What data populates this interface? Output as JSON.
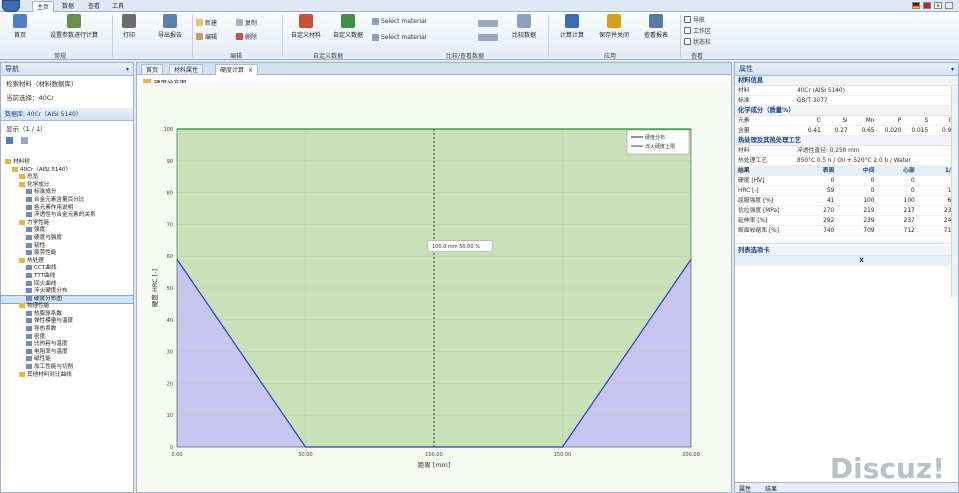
{
  "ribbon_tabs": [
    "主页",
    "数据",
    "查看",
    "工具"
  ],
  "ribbon": {
    "buttons": [
      {
        "name": "home-button",
        "label": "首页",
        "color": "#4f7fc4"
      },
      {
        "name": "params-button",
        "label": "设置参数进行计算",
        "color": "#6b8e4e"
      },
      {
        "name": "print-button",
        "label": "打印",
        "color": "#6c6c6c"
      },
      {
        "name": "export-button",
        "label": "导出报告",
        "color": "#5b7fae"
      },
      {
        "name": "customize-button",
        "label": "自定义材料",
        "color": "#c6503a"
      },
      {
        "name": "library-button",
        "label": "自定义数据",
        "color": "#3f8f49"
      },
      {
        "name": "compare-button",
        "label": "比较数据",
        "color": "#8aa0bd"
      },
      {
        "name": "calc-button",
        "label": "计算计算",
        "color": "#3c6cb0"
      },
      {
        "name": "save-results-button",
        "label": "保存并关闭",
        "color": "#d4a01e"
      },
      {
        "name": "report-button",
        "label": "查看报表",
        "color": "#5a78a2"
      }
    ],
    "small_items": [
      "新建",
      "复制",
      "删除",
      "编辑",
      "Select material",
      "Select material"
    ],
    "groups": [
      "常规",
      "编辑",
      "自定义数据",
      "比较/查看数据",
      "应用",
      "查看"
    ],
    "right_items": [
      "导航",
      "工作区",
      "状态栏"
    ]
  },
  "flags": [
    "#1a1a1a",
    "#c02626",
    "#ffffff"
  ],
  "left_panel": {
    "title": "导航",
    "line1": "检索材料（材料数据库）",
    "line2": "当前选择：40Cr",
    "section": "数据库: 40Cr（AISI 5140）",
    "toolbar": "显示（1 / 1）",
    "tree": [
      {
        "level": 0,
        "label": "材料树"
      },
      {
        "level": 1,
        "label": "40Cr（AISI 5140）"
      },
      {
        "level": 2,
        "label": "总览"
      },
      {
        "level": 2,
        "label": "化学成分"
      },
      {
        "level": 3,
        "label": "标准成分"
      },
      {
        "level": 3,
        "label": "合金元素含量百分比"
      },
      {
        "level": 3,
        "label": "各元素作用说明"
      },
      {
        "level": 3,
        "label": "淬透性与合金元素的关系"
      },
      {
        "level": 2,
        "label": "力学性能"
      },
      {
        "level": 3,
        "label": "强度"
      },
      {
        "level": 3,
        "label": "硬度与强度"
      },
      {
        "level": 3,
        "label": "韧性"
      },
      {
        "level": 3,
        "label": "疲劳性能"
      },
      {
        "level": 2,
        "label": "热处理"
      },
      {
        "level": 3,
        "label": "CCT曲线"
      },
      {
        "level": 3,
        "label": "TTT曲线"
      },
      {
        "level": 3,
        "label": "回火曲线"
      },
      {
        "level": 3,
        "label": "淬火硬度分布"
      },
      {
        "level": 3,
        "label": "硬度分布图"
      },
      {
        "level": 2,
        "label": "物理性能"
      },
      {
        "level": 3,
        "label": "热膨胀系数"
      },
      {
        "level": 3,
        "label": "弹性模量与温度"
      },
      {
        "level": 3,
        "label": "导热系数"
      },
      {
        "level": 3,
        "label": "密度"
      },
      {
        "level": 3,
        "label": "比热容与温度"
      },
      {
        "level": 3,
        "label": "电阻率与温度"
      },
      {
        "level": 3,
        "label": "磁性能"
      },
      {
        "level": 3,
        "label": "加工性能与切削"
      },
      {
        "level": 2,
        "label": "其他材料对比曲线"
      }
    ],
    "selected_index": 18
  },
  "center": {
    "tabs": [
      "首页",
      "材料属性",
      "硬度计算"
    ],
    "active_tab": 2,
    "panel_title": "硬度分布图",
    "chart_data": {
      "type": "area",
      "title": "",
      "xlabel": "距离 [mm]",
      "ylabel": "硬度 HRC [-]",
      "xlim": [
        0,
        200
      ],
      "ylim": [
        0,
        100
      ],
      "xticks": [
        "0.00",
        "50.00",
        "100.00",
        "150.00",
        "200.00"
      ],
      "yticks": [
        "0",
        "10",
        "20",
        "30",
        "40",
        "50",
        "60",
        "70",
        "80",
        "90",
        "100"
      ],
      "series": [
        {
          "name": "硬度分布",
          "x": [
            0,
            50,
            150,
            200
          ],
          "y": [
            59,
            0,
            0,
            59
          ],
          "color": "#1f3fd6"
        },
        {
          "name": "淬火硬度上限",
          "x": [
            0,
            200
          ],
          "y": [
            100,
            100
          ],
          "color": "#2f8a2f"
        }
      ],
      "cursor_x": 100,
      "cursor_label": "100.0 mm 50.00 %",
      "grid": true,
      "legend_position": "top-right"
    }
  },
  "right_panel": {
    "title": "属性",
    "material_section": "材料信息",
    "material_rows": [
      [
        "材料",
        "40Cr (AISI 5140)"
      ],
      [
        "标准",
        "GB/T 3077"
      ]
    ],
    "chem_section": "化学成分（质量%）",
    "chem_header": [
      "元素",
      "C",
      "Si",
      "Mn",
      "P",
      "S",
      "Cr"
    ],
    "chem_values": [
      "含量",
      "0.41",
      "0.27",
      "0.65",
      "0.020",
      "0.015",
      "0.95"
    ],
    "heat_section": "热处理及其热处理工艺",
    "heat_rows": [
      [
        "材料",
        "淬透性直径: 0.250 mm"
      ],
      [
        "热处理工艺",
        "850°C 0.5 h / Oil + 520°C 2.0 h / Water"
      ]
    ],
    "prop_header": [
      "结果",
      "表面",
      "中间",
      "心部",
      "1/2"
    ],
    "prop_rows": [
      [
        "硬度 [HV]",
        "0",
        "0",
        "0",
        "0"
      ],
      [
        "HRC [-]",
        "59",
        "0",
        "0",
        "12"
      ],
      [
        "屈服强度 [%]",
        "41",
        "100",
        "100",
        "69"
      ],
      [
        "抗拉强度 [MPa]",
        "270",
        "219",
        "217",
        "231"
      ],
      [
        "延伸率 [%]",
        "292",
        "239",
        "237",
        "241"
      ],
      [
        "断面收缩率 [%]",
        "740",
        "709",
        "712",
        "713"
      ]
    ],
    "list_section": "列表选项卡",
    "list_col": "X",
    "bottom_tabs": [
      "属性",
      "结果"
    ]
  },
  "watermark": "Discuz!"
}
